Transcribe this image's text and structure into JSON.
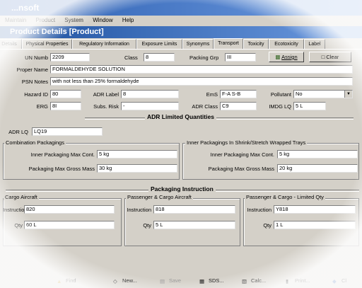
{
  "app": {
    "title": "...nsoft"
  },
  "menu": [
    "Maintain",
    "Product",
    "System",
    "Window",
    "Help"
  ],
  "window": {
    "title": "Product Details [Product]"
  },
  "tabs": [
    "Details",
    "Physical Properties",
    "Regulatory Information",
    "Exposure Limits",
    "Synonyms",
    "Transport",
    "Toxicity",
    "Ecotoxicity",
    "Label"
  ],
  "fields": {
    "un_label": "UN Numb",
    "un_value": "2209",
    "class_label": "Class",
    "class_value": "8",
    "pkg_label": "Packing Grp",
    "pkg_value": "III",
    "assign_label": "Assign",
    "clear_label": "Clear",
    "proper_label": "Proper Name",
    "proper_value": "FORMALDEHYDE SOLUTION",
    "psn_label": "PSN Notes",
    "psn_value": "with not less than 25% formaldehyde",
    "hazard_label": "Hazard ID",
    "hazard_value": "80",
    "adrlabel_label": "ADR Label",
    "adrlabel_value": "8",
    "ems_label": "EmS",
    "ems_value": "F-A S-B",
    "pollutant_label": "Pollutant",
    "pollutant_value": "No",
    "erg_label": "ERG",
    "erg_value": "8I",
    "subs_label": "Subs. Risk",
    "subs_value": "-",
    "adrclass_label": "ADR Class",
    "adrclass_value": "C9",
    "imdg_label": "IMDG LQ",
    "imdg_value": "5 L"
  },
  "adr": {
    "section_title": "ADR Limited Quantities",
    "lq_label": "ADR LQ",
    "lq_value": "LQ19",
    "combo_title": "Combination Packagings",
    "inner_label": "Inner Packaging Max Cont.",
    "inner_value": "5 kg",
    "gross_label": "Packaging Max Gross Mass",
    "gross_value": "30 kg",
    "shrink_title": "Inner Packagings In Shrink/Stretch Wrapped Trays",
    "shrink_inner_label": "Inner Packaging Max Cont.",
    "shrink_inner_value": "5 kg",
    "shrink_gross_label": "Packaging Max Gross Mass",
    "shrink_gross_value": "20 kg"
  },
  "packing": {
    "section_title": "Packaging Instruction",
    "groups": [
      {
        "title": "Cargo Aircraft",
        "instr_label": "Instruction",
        "instr_value": "820",
        "qty_label": "Qty",
        "qty_value": "60 L"
      },
      {
        "title": "Passenger & Cargo Aircraft",
        "instr_label": "Instruction",
        "instr_value": "818",
        "qty_label": "Qty",
        "qty_value": "5 L"
      },
      {
        "title": "Passenger & Cargo - Limited Qty",
        "instr_label": "Instruction",
        "instr_value": "Y818",
        "qty_label": "Qty",
        "qty_value": "1 L"
      }
    ]
  },
  "toolbar": [
    "Find",
    "New...",
    "Save",
    "SDS...",
    "Calc...",
    "Print...",
    "Cl"
  ],
  "colors": {
    "title_blue": "#1c4f9e",
    "window_gray": "#d4d0c8"
  }
}
